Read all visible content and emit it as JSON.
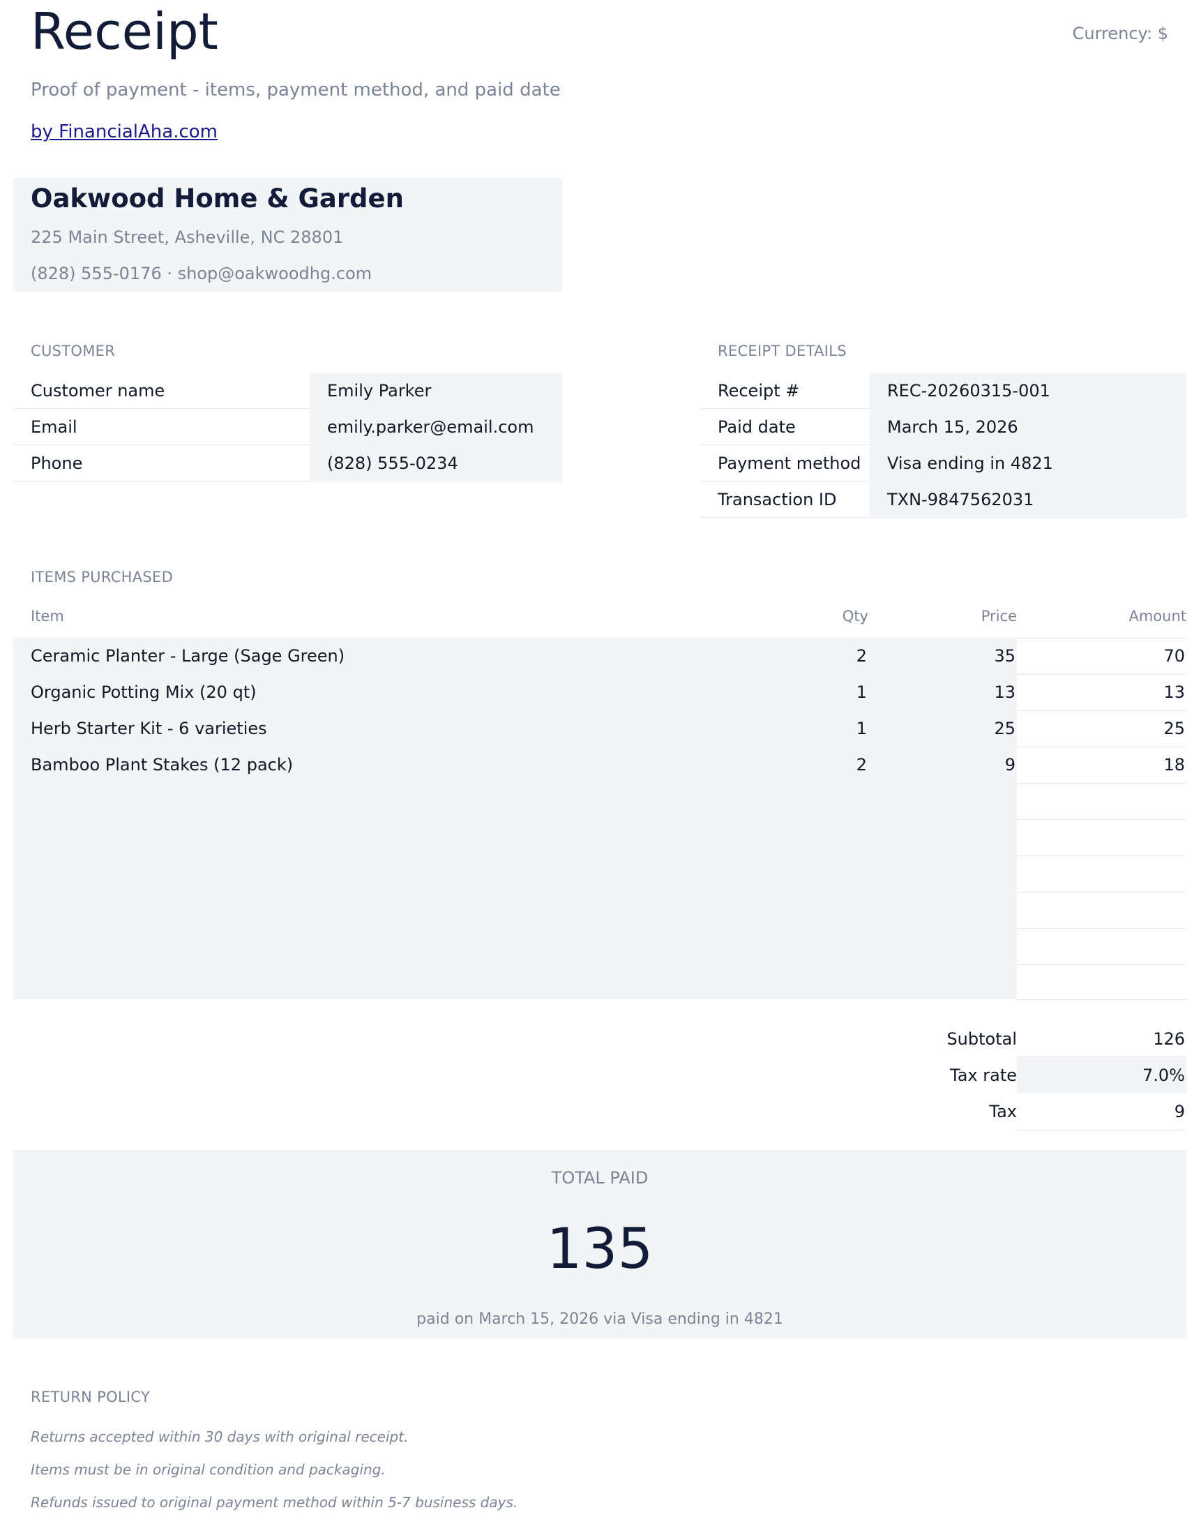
{
  "header": {
    "title": "Receipt",
    "currency": "Currency: $",
    "subtitle": "Proof of payment - items, payment method, and paid date",
    "byline": "by FinancialAha.com"
  },
  "store": {
    "name": "Oakwood Home & Garden",
    "address": "225 Main Street, Asheville, NC 28801",
    "contact": "(828) 555-0176  ·  shop@oakwoodhg.com"
  },
  "customer": {
    "section_label": "CUSTOMER",
    "rows": [
      {
        "label": "Customer name",
        "value": "Emily Parker"
      },
      {
        "label": "Email",
        "value": "emily.parker@email.com"
      },
      {
        "label": "Phone",
        "value": "(828) 555-0234"
      }
    ]
  },
  "receipt_details": {
    "section_label": "RECEIPT DETAILS",
    "rows": [
      {
        "label": "Receipt #",
        "value": "REC-20260315-001"
      },
      {
        "label": "Paid date",
        "value": "March 15, 2026"
      },
      {
        "label": "Payment method",
        "value": "Visa ending in 4821"
      },
      {
        "label": "Transaction ID",
        "value": "TXN-9847562031"
      }
    ]
  },
  "items": {
    "section_label": "ITEMS PURCHASED",
    "columns": {
      "item": "Item",
      "qty": "Qty",
      "price": "Price",
      "amount": "Amount"
    },
    "rows": [
      {
        "item": "Ceramic Planter - Large (Sage Green)",
        "qty": "2",
        "price": "35",
        "amount": "70"
      },
      {
        "item": "Organic Potting Mix (20 qt)",
        "qty": "1",
        "price": "13",
        "amount": "13"
      },
      {
        "item": "Herb Starter Kit - 6 varieties",
        "qty": "1",
        "price": "25",
        "amount": "25"
      },
      {
        "item": "Bamboo Plant Stakes (12 pack)",
        "qty": "2",
        "price": "9",
        "amount": "18"
      }
    ]
  },
  "totals": {
    "subtotal_label": "Subtotal",
    "subtotal": "126",
    "tax_rate_label": "Tax rate",
    "tax_rate": "7.0%",
    "tax_label": "Tax",
    "tax": "9"
  },
  "total_paid": {
    "label": "TOTAL PAID",
    "amount": "135",
    "note": "paid on March 15, 2026 via Visa ending in 4821"
  },
  "return_policy": {
    "section_label": "RETURN POLICY",
    "lines": [
      "Returns accepted within 30 days with original receipt.",
      "Items must be in original condition and packaging.",
      "Refunds issued to original payment method within 5-7 business days."
    ]
  }
}
